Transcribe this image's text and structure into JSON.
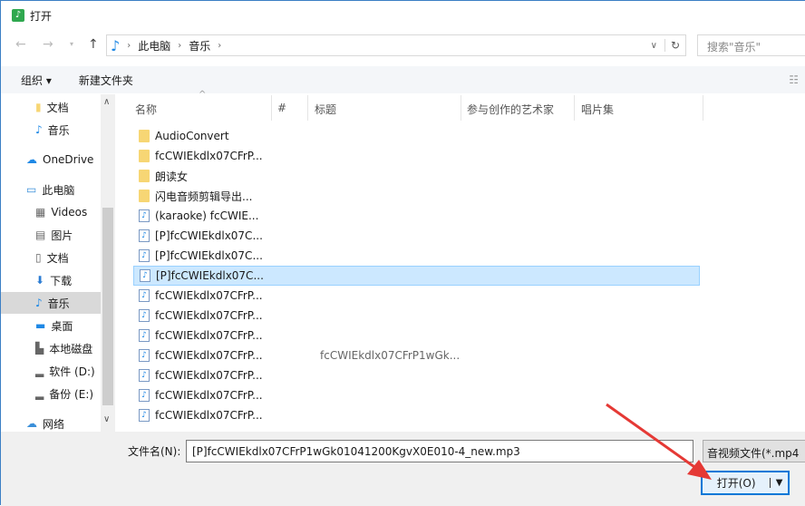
{
  "window": {
    "title": "打开"
  },
  "address": {
    "crumbs": [
      "此电脑",
      "音乐"
    ],
    "search_placeholder": "搜索\"音乐\""
  },
  "toolbar": {
    "organize": "组织 ▾",
    "new_folder": "新建文件夹"
  },
  "sidebar": {
    "items": [
      {
        "label": "文档",
        "icon": "folder-icon"
      },
      {
        "label": "音乐",
        "icon": "music-icon"
      },
      {
        "label": "OneDrive",
        "icon": "cloud-icon"
      },
      {
        "label": "此电脑",
        "icon": "computer-icon"
      },
      {
        "label": "Videos",
        "icon": "video-icon"
      },
      {
        "label": "图片",
        "icon": "picture-icon"
      },
      {
        "label": "文档",
        "icon": "document-icon"
      },
      {
        "label": "下载",
        "icon": "download-icon"
      },
      {
        "label": "音乐",
        "icon": "music-icon",
        "selected": true
      },
      {
        "label": "桌面",
        "icon": "desktop-icon"
      },
      {
        "label": "本地磁盘",
        "icon": "disk-icon"
      },
      {
        "label": "软件 (D:)",
        "icon": "drive-icon"
      },
      {
        "label": "备份 (E:)",
        "icon": "drive-icon"
      },
      {
        "label": "网络",
        "icon": "network-icon"
      }
    ]
  },
  "columns": [
    "名称",
    "#",
    "标题",
    "参与创作的艺术家",
    "唱片集"
  ],
  "files": [
    {
      "name": "AudioConvert",
      "type": "folder",
      "title": ""
    },
    {
      "name": "fcCWIEkdlx07CFrP...",
      "type": "folder",
      "title": ""
    },
    {
      "name": "朗读女",
      "type": "folder",
      "title": ""
    },
    {
      "name": "闪电音频剪辑导出...",
      "type": "folder",
      "title": ""
    },
    {
      "name": "(karaoke) fcCWIE...",
      "type": "audio",
      "title": ""
    },
    {
      "name": "[P]fcCWIEkdlx07C...",
      "type": "audio",
      "title": ""
    },
    {
      "name": "[P]fcCWIEkdlx07C...",
      "type": "audio",
      "title": ""
    },
    {
      "name": "[P]fcCWIEkdlx07C...",
      "type": "audio",
      "title": "",
      "selected": true
    },
    {
      "name": "fcCWIEkdlx07CFrP...",
      "type": "audio",
      "title": ""
    },
    {
      "name": "fcCWIEkdlx07CFrP...",
      "type": "audio",
      "title": ""
    },
    {
      "name": "fcCWIEkdlx07CFrP...",
      "type": "audio",
      "title": ""
    },
    {
      "name": "fcCWIEkdlx07CFrP...",
      "type": "audio",
      "title": "fcCWIEkdlx07CFrP1wGk..."
    },
    {
      "name": "fcCWIEkdlx07CFrP...",
      "type": "audio",
      "title": ""
    },
    {
      "name": "fcCWIEkdlx07CFrP...",
      "type": "audio",
      "title": ""
    },
    {
      "name": "fcCWIEkdlx07CFrP...",
      "type": "audio",
      "title": ""
    }
  ],
  "footer": {
    "filename_label": "文件名(N):",
    "filename": "[P]fcCWIEkdlx07CFrP1wGk01041200KgvX0E010-4_new.mp3",
    "filetype": "音视频文件(*.mp4",
    "open": "打开(O)"
  }
}
